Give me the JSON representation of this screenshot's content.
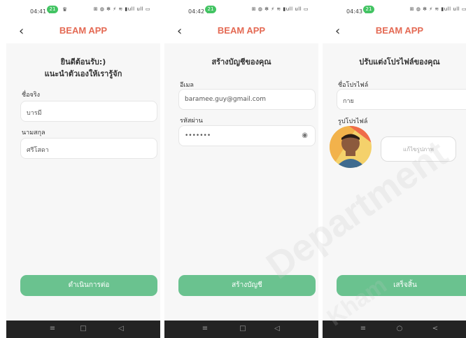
{
  "brand": {
    "title": "BEAM APP",
    "title_color": "#e46a54",
    "button_color": "#6ac28f"
  },
  "screens": [
    {
      "status": {
        "time": "04:41 น.",
        "pill": "21",
        "extra": "♛",
        "icons": "⊞ ◍ ✻ ⚡ ≋ ▮ull ull ▭"
      },
      "welcome_line1": "ยินดีต้อนรับ:)",
      "welcome_line2": "แนะนำตัวเองให้เรารู้จัก",
      "first_name_label": "ชื่อจริง",
      "first_name_value": "บารมี",
      "last_name_label": "นามสกุล",
      "last_name_value": "ศรีโสดา",
      "continue_label": "ดำเนินการต่อ",
      "nav": {
        "menu": "≡",
        "home": "□",
        "back": "◁"
      }
    },
    {
      "status": {
        "time": "04:42 น.",
        "pill": "21",
        "icons": "⊞ ◍ ✻ ⚡ ≋ ▮ull ull ▭"
      },
      "heading": "สร้างบัญชีของคุณ",
      "email_label": "อีเมล",
      "email_value": "baramee.guy@gmail.com",
      "password_label": "รหัสผ่าน",
      "password_value": "•••••••",
      "create_label": "สร้างบัญชี",
      "nav": {
        "menu": "≡",
        "home": "□",
        "back": "◁"
      }
    },
    {
      "status": {
        "time": "04:43 น.",
        "pill": "21",
        "icons": "⊞ ◍ ✻ ⚡ ≋ ▮ull ull ▭"
      },
      "heading": "ปรับแต่งโปรไฟล์ของคุณ",
      "profile_name_label": "ชื่อโปรไฟล์",
      "profile_name_value": "กาย",
      "profile_photo_label": "รูปโปรไฟล์",
      "edit_photo_label": "แก้ไขรูปภาพ",
      "done_label": "เสร็จสิ้น",
      "nav": {
        "menu": "≡",
        "home": "○",
        "back": "<"
      }
    }
  ],
  "watermark": {
    "line1": "Department",
    "line2": "Kham"
  }
}
